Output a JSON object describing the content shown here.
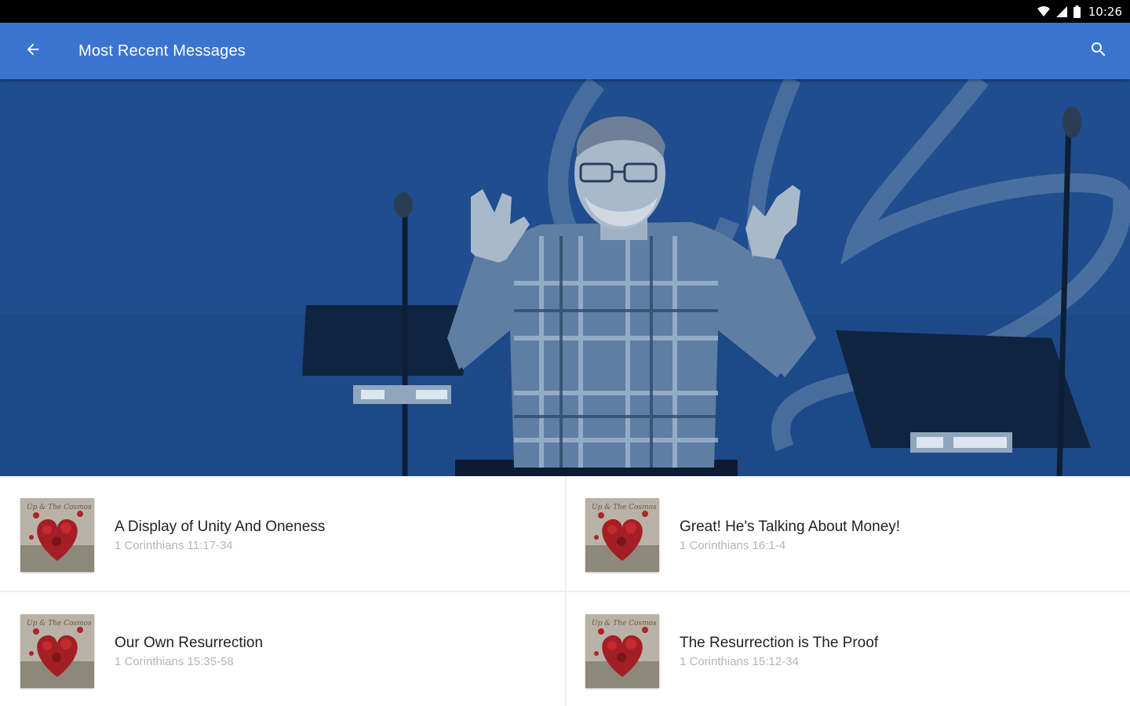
{
  "status_bar": {
    "time": "10:26",
    "icons": [
      "wifi-icon",
      "signal-icon",
      "battery-icon"
    ]
  },
  "app_bar": {
    "title": "Most Recent Messages",
    "back_icon": "arrow-back-icon",
    "search_icon": "search-icon",
    "background_color": "#3a74d0"
  },
  "hero": {
    "image": "speaker-on-stage"
  },
  "messages": [
    {
      "title": "A Display of Unity And Oneness",
      "reference": "1 Corinthians 11:17-34",
      "thumbnail": "series-artwork-hearts"
    },
    {
      "title": "Great! He's Talking About Money!",
      "reference": "1 Corinthians 16:1-4",
      "thumbnail": "series-artwork-hearts"
    },
    {
      "title": "Our Own Resurrection",
      "reference": "1 Corinthians 15:35-58",
      "thumbnail": "series-artwork-hearts"
    },
    {
      "title": "The Resurrection is The Proof",
      "reference": "1 Corinthians 15:12-34",
      "thumbnail": "series-artwork-hearts"
    }
  ]
}
